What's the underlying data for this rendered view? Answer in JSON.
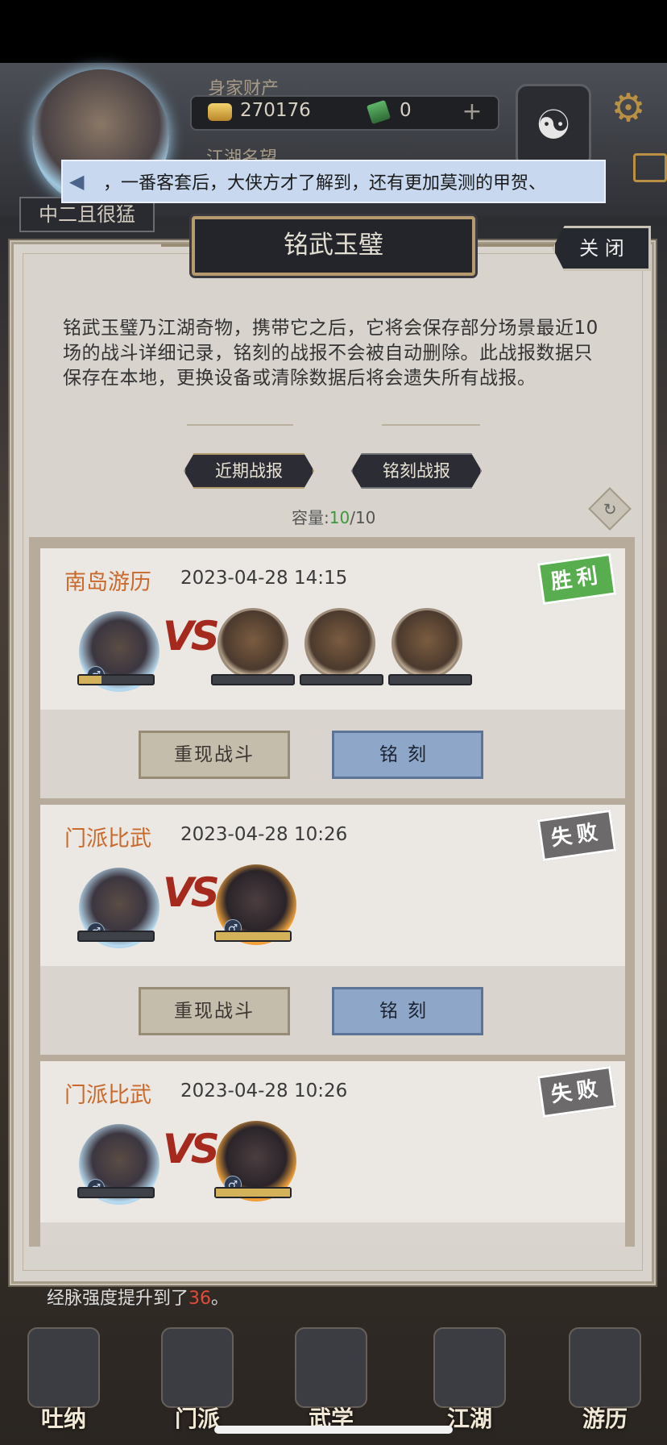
{
  "header": {
    "wealth_label": "身家财产",
    "gold": "270176",
    "jade": "0",
    "fame_label": "江湖名望",
    "player_title": "中二且很猛"
  },
  "marquee": {
    "text": "，一番客套后，大侠方才了解到，还有更加莫测的甲贺、"
  },
  "modal": {
    "title": "铭武玉璧",
    "close_label": "关 闭",
    "description": "铭武玉璧乃江湖奇物，携带它之后，它将会保存部分场景最近10场的战斗详细记录，铭刻的战报不会被自动删除。此战报数据只保存在本地，更换设备或清除数据后将会遗失所有战报。",
    "tabs": [
      "近期战报",
      "铭刻战报"
    ],
    "capacity_label": "容量:",
    "capacity_used": "10",
    "capacity_total": "/10"
  },
  "reports": [
    {
      "mode": "南岛游历",
      "time": "2023-04-28 14:15",
      "result": "胜利",
      "player_hp": 0.3,
      "replay_label": "重现战斗",
      "engrave_label": "铭刻"
    },
    {
      "mode": "门派比武",
      "time": "2023-04-28 10:26",
      "result": "失败",
      "player_hp": 0,
      "enemy_hp": 1.0,
      "replay_label": "重现战斗",
      "engrave_label": "铭刻"
    },
    {
      "mode": "门派比武",
      "time": "2023-04-28 10:26",
      "result": "失败",
      "player_hp": 0,
      "enemy_hp": 1.0
    }
  ],
  "vs_label": "VS",
  "log": {
    "prefix": "经脉强度提升到了",
    "value": "36",
    "suffix": "。"
  },
  "nav": [
    "吐纳",
    "门派",
    "武学",
    "江湖",
    "游历"
  ],
  "colors": {
    "mode_text": "#c96a2c",
    "win": "#58ad4e",
    "lose": "#6c6a6a",
    "engrave_button": "#8ea6c8"
  }
}
